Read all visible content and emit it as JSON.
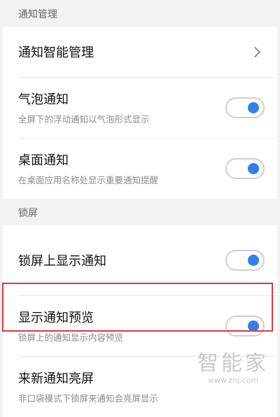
{
  "sections": {
    "notification": {
      "header": "通知管理",
      "smart": {
        "title": "通知智能管理"
      },
      "bubble": {
        "title": "气泡通知",
        "subtitle": "全屏下的浮动通知以气泡形式显示",
        "enabled": true
      },
      "desktop": {
        "title": "桌面通知",
        "subtitle": "在桌面应用名称处显示重要通知提醒",
        "enabled": true
      }
    },
    "lockscreen": {
      "header": "锁屏",
      "show_on_lock": {
        "title": "锁屏上显示通知",
        "enabled": true
      },
      "preview": {
        "title": "显示通知预览",
        "subtitle": "锁屏上的通知显示内容预览",
        "enabled": true
      },
      "wake": {
        "title": "来新通知亮屏",
        "subtitle": "非口袋模式下锁屏来通知会亮屏显示"
      }
    }
  },
  "watermark": {
    "text": "智能家",
    "url": "www.znj.com"
  },
  "colors": {
    "accent": "#2f80ed",
    "highlight": "#d9393e",
    "background": "#f2f2f2"
  }
}
